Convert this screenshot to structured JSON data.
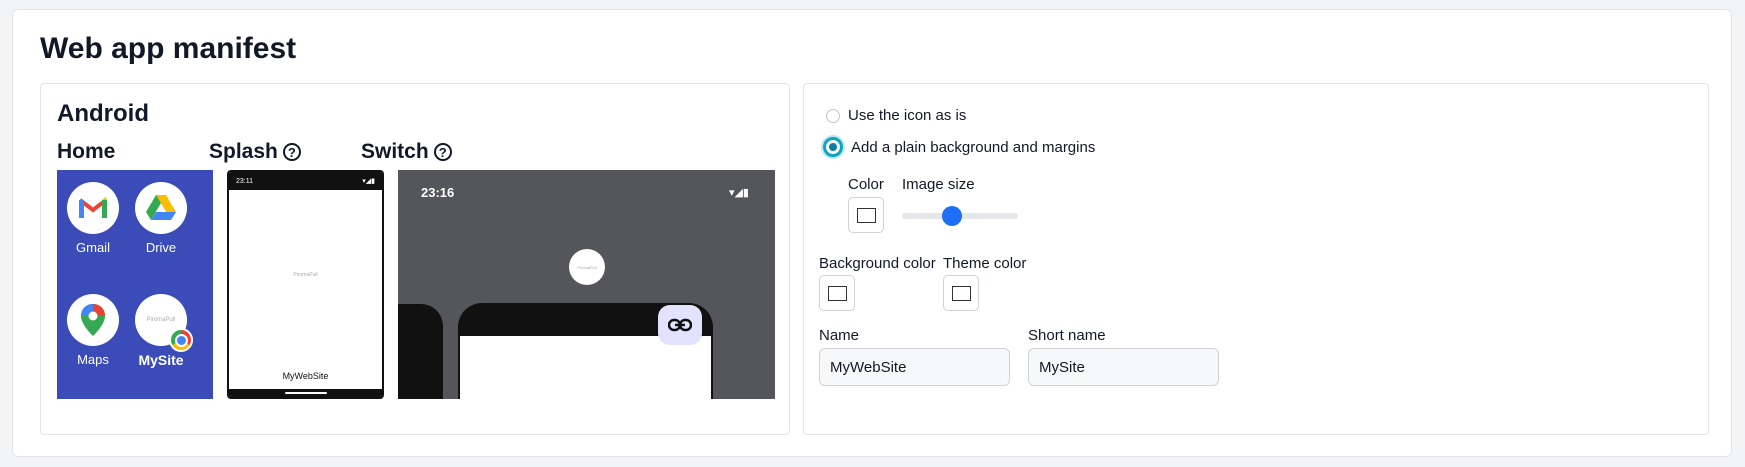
{
  "title": "Web app manifest",
  "android": {
    "heading": "Android",
    "home": {
      "label": "Home",
      "apps": [
        {
          "name": "Gmail",
          "icon": "gmail-icon"
        },
        {
          "name": "Drive",
          "icon": "drive-icon"
        },
        {
          "name": "Maps",
          "icon": "maps-icon"
        },
        {
          "name": "MySite",
          "icon": "site-icon"
        }
      ],
      "site_logo_text": "PiromaPull"
    },
    "splash": {
      "label": "Splash",
      "status_time": "23:11",
      "logo_text": "PiromaPull",
      "app_name": "MyWebSite"
    },
    "switch": {
      "label": "Switch",
      "status_time": "23:16",
      "logo_text": "PiromaPull"
    }
  },
  "options": {
    "radio_as_is": "Use the icon as is",
    "radio_plain": "Add a plain background and margins",
    "selected": "plain",
    "color_label": "Color",
    "image_size_label": "Image size",
    "image_size_value": 0.42,
    "background_color_label": "Background color",
    "theme_color_label": "Theme color",
    "name_label": "Name",
    "name_value": "MyWebSite",
    "short_name_label": "Short name",
    "short_name_value": "MySite"
  },
  "colors": {
    "home_bg": "#3b4cb8",
    "switch_bg": "#55565b",
    "accent": "#0ea5c0",
    "slider": "#1f6ef5"
  }
}
